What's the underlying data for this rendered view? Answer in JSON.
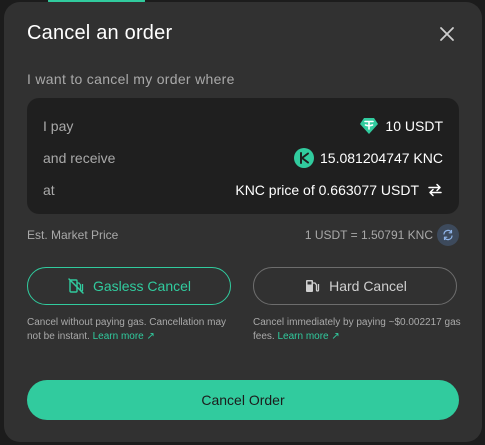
{
  "modal": {
    "title": "Cancel an order",
    "subtitle": "I want to cancel my order where"
  },
  "order": {
    "pay_label": "I pay",
    "pay_value": "10 USDT",
    "pay_token_icon": "usdt-token-icon",
    "receive_label": "and receive",
    "receive_value": "15.081204747 KNC",
    "receive_token_icon": "knc-token-icon",
    "at_label": "at",
    "at_value": "KNC price of 0.663077 USDT"
  },
  "market": {
    "label": "Est. Market Price",
    "rate": "1 USDT = 1.50791 KNC"
  },
  "options": {
    "gasless_label": "Gasless Cancel",
    "gasless_desc": "Cancel without paying gas. Cancellation may not be instant.",
    "gasless_link": "Learn more",
    "hard_label": "Hard Cancel",
    "hard_desc": "Cancel immediately by paying ~$0.002217 gas fees.",
    "hard_link": "Learn more"
  },
  "cta": {
    "label": "Cancel Order"
  },
  "colors": {
    "accent": "#31cb9e",
    "modal_bg": "#313131",
    "box_bg": "#1f1f1f"
  }
}
